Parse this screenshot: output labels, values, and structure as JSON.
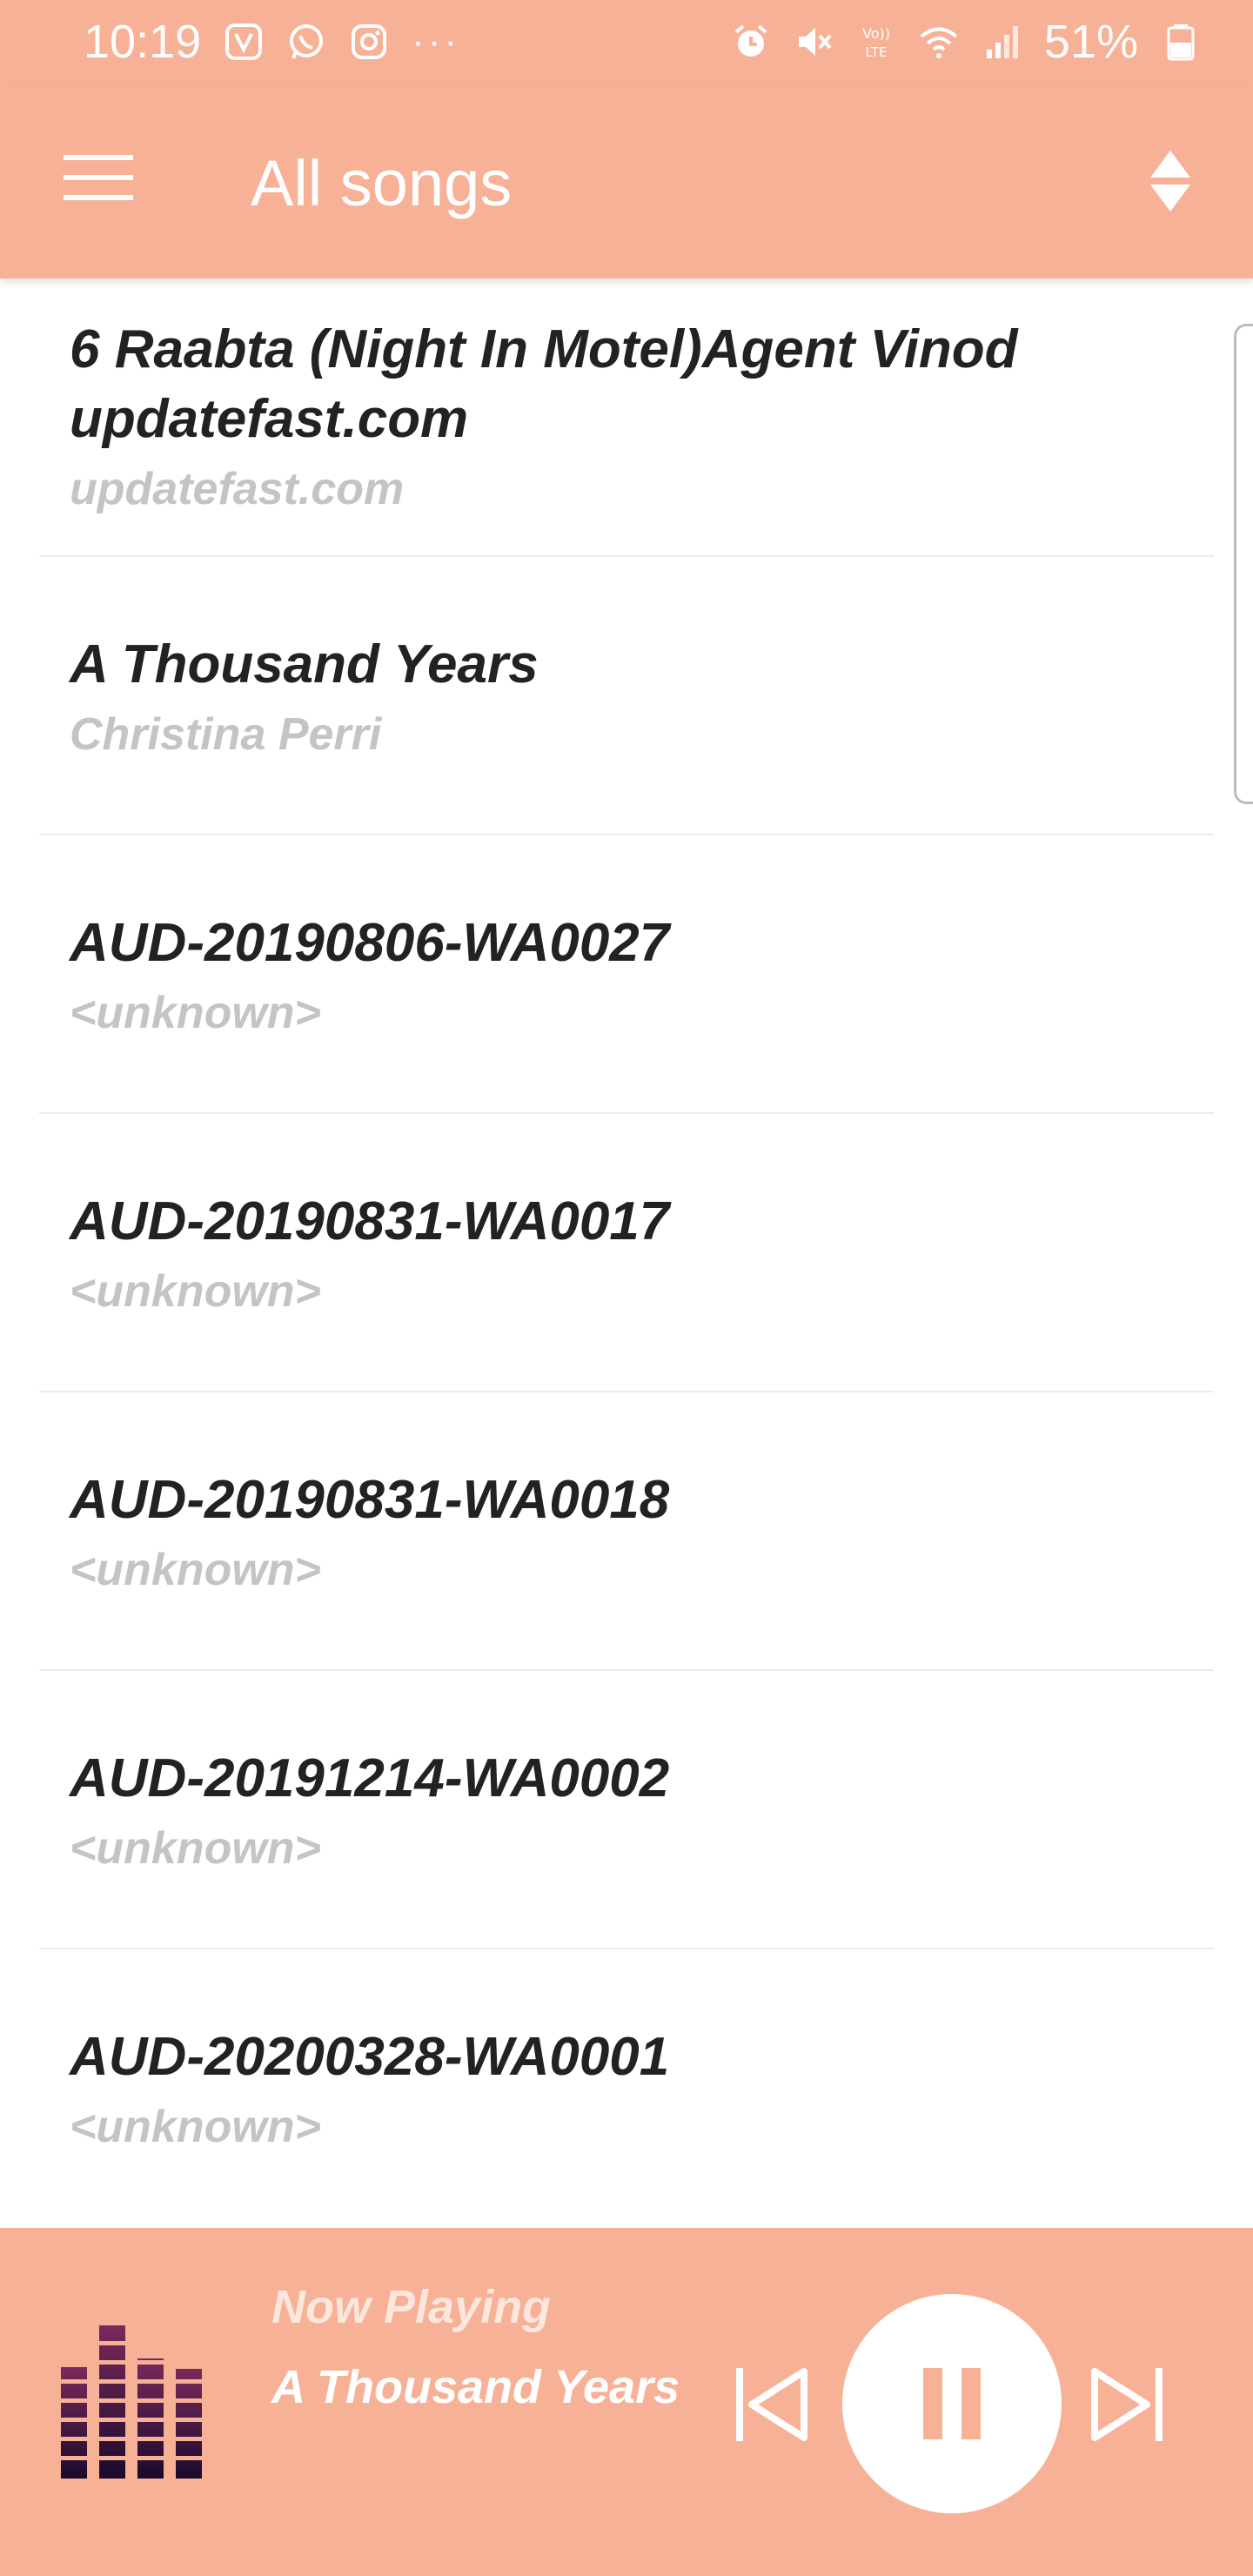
{
  "status_bar": {
    "time": "10:19",
    "ellipsis": "···",
    "battery": "51%",
    "icons_left": [
      "jiosaavn-icon",
      "whatsapp-icon",
      "instagram-icon"
    ],
    "icons_right": [
      "alarm-icon",
      "mute-icon",
      "volte-icon",
      "wifi-icon",
      "signal-icon",
      "battery-icon"
    ]
  },
  "app_bar": {
    "title": "All songs",
    "menu_icon": "hamburger-menu-icon",
    "sort_icon": "sort-icon"
  },
  "songs": [
    {
      "title": "6 Raabta (Night In Motel)Agent Vinod updatefast.com",
      "artist": "updatefast.com"
    },
    {
      "title": "A Thousand Years",
      "artist": "Christina Perri"
    },
    {
      "title": "AUD-20190806-WA0027",
      "artist": "<unknown>"
    },
    {
      "title": "AUD-20190831-WA0017",
      "artist": "<unknown>"
    },
    {
      "title": "AUD-20190831-WA0018",
      "artist": "<unknown>"
    },
    {
      "title": "AUD-20191214-WA0002",
      "artist": "<unknown>"
    },
    {
      "title": "AUD-20200328-WA0001",
      "artist": "<unknown>"
    }
  ],
  "player": {
    "label": "Now Playing",
    "song": "A Thousand Years",
    "controls": [
      "previous-icon",
      "pause-icon",
      "next-icon"
    ]
  },
  "colors": {
    "accent": "#f7b196",
    "title_text": "#222222",
    "subtitle_text": "#c4c4c4",
    "equalizer": "#2a0e3a"
  }
}
